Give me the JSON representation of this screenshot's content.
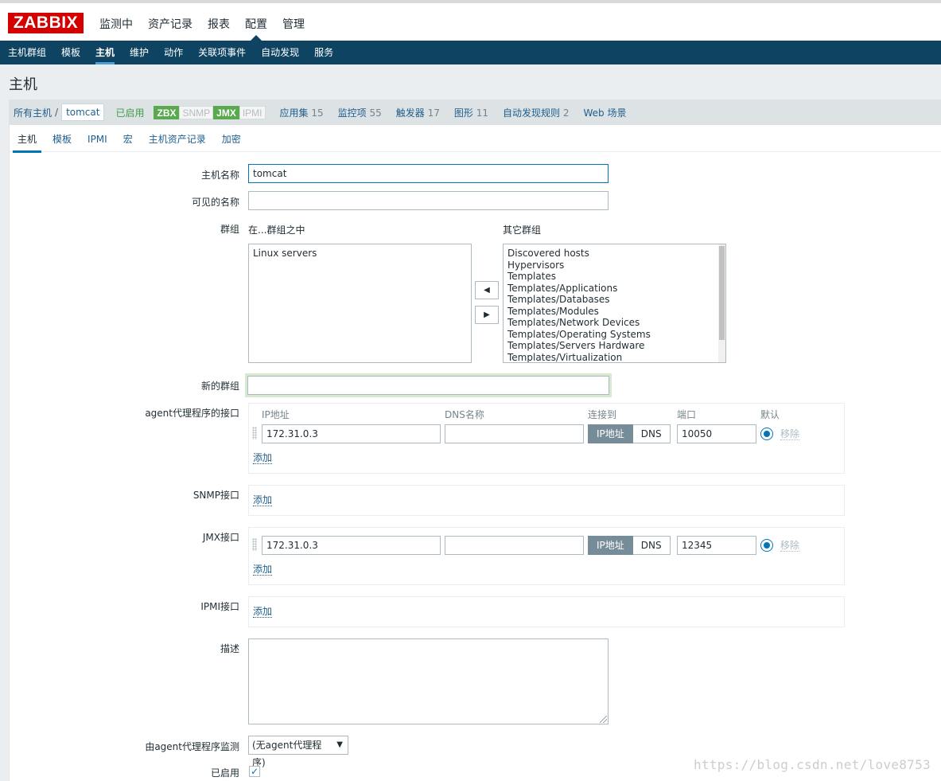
{
  "app": {
    "logo": "ZABBIX"
  },
  "top_menu": [
    {
      "label": "监测中",
      "active": false
    },
    {
      "label": "资产记录",
      "active": false
    },
    {
      "label": "报表",
      "active": false
    },
    {
      "label": "配置",
      "active": true
    },
    {
      "label": "管理",
      "active": false
    }
  ],
  "sub_menu": [
    {
      "label": "主机群组",
      "active": false
    },
    {
      "label": "模板",
      "active": false
    },
    {
      "label": "主机",
      "active": true
    },
    {
      "label": "维护",
      "active": false
    },
    {
      "label": "动作",
      "active": false
    },
    {
      "label": "关联项事件",
      "active": false
    },
    {
      "label": "自动发现",
      "active": false
    },
    {
      "label": "服务",
      "active": false
    }
  ],
  "page_title": "主机",
  "host_bar": {
    "all_hosts": "所有主机",
    "separator": "/",
    "current_host": "tomcat",
    "status": "已启用",
    "badges": [
      {
        "label": "ZBX",
        "active": true
      },
      {
        "label": "SNMP",
        "active": false
      },
      {
        "label": "JMX",
        "active": true
      },
      {
        "label": "IPMI",
        "active": false
      }
    ],
    "links": [
      {
        "label": "应用集",
        "count": "15"
      },
      {
        "label": "监控项",
        "count": "55"
      },
      {
        "label": "触发器",
        "count": "17"
      },
      {
        "label": "图形",
        "count": "11"
      },
      {
        "label": "自动发现规则",
        "count": "2"
      },
      {
        "label": "Web 场景",
        "count": ""
      }
    ]
  },
  "form_tabs": [
    {
      "label": "主机",
      "active": true
    },
    {
      "label": "模板",
      "active": false
    },
    {
      "label": "IPMI",
      "active": false
    },
    {
      "label": "宏",
      "active": false
    },
    {
      "label": "主机资产记录",
      "active": false
    },
    {
      "label": "加密",
      "active": false
    }
  ],
  "form": {
    "host_name_label": "主机名称",
    "host_name_value": "tomcat",
    "visible_name_label": "可见的名称",
    "visible_name_value": "",
    "groups_label": "群组",
    "in_groups_label": "在...群组之中",
    "other_groups_label": "其它群组",
    "in_groups": [
      "Linux servers"
    ],
    "other_groups": [
      "Discovered hosts",
      "Hypervisors",
      "Templates",
      "Templates/Applications",
      "Templates/Databases",
      "Templates/Modules",
      "Templates/Network Devices",
      "Templates/Operating Systems",
      "Templates/Servers Hardware",
      "Templates/Virtualization"
    ],
    "move_left_glyph": "◀",
    "move_right_glyph": "▶",
    "new_group_label": "新的群组",
    "new_group_value": "",
    "agent_interface_label": "agent代理程序的接口",
    "if_headers": {
      "ip": "IP地址",
      "dns": "DNS名称",
      "connect": "连接到",
      "port": "端口",
      "default": "默认"
    },
    "agent_interface": {
      "ip": "172.31.0.3",
      "dns": "",
      "connect_ip": "IP地址",
      "connect_dns": "DNS",
      "port": "10050",
      "remove": "移除"
    },
    "add_label": "添加",
    "snmp_label": "SNMP接口",
    "jmx_label": "JMX接口",
    "jmx_interface": {
      "ip": "172.31.0.3",
      "dns": "",
      "connect_ip": "IP地址",
      "connect_dns": "DNS",
      "port": "12345",
      "remove": "移除"
    },
    "ipmi_label": "IPMI接口",
    "description_label": "描述",
    "description_value": "",
    "proxy_label": "由agent代理程序监测",
    "proxy_value": "(无agent代理程序)",
    "proxy_caret": "▼",
    "enabled_label": "已启用",
    "enabled_check": "✓"
  },
  "watermark": "https://blog.csdn.net/love8753"
}
